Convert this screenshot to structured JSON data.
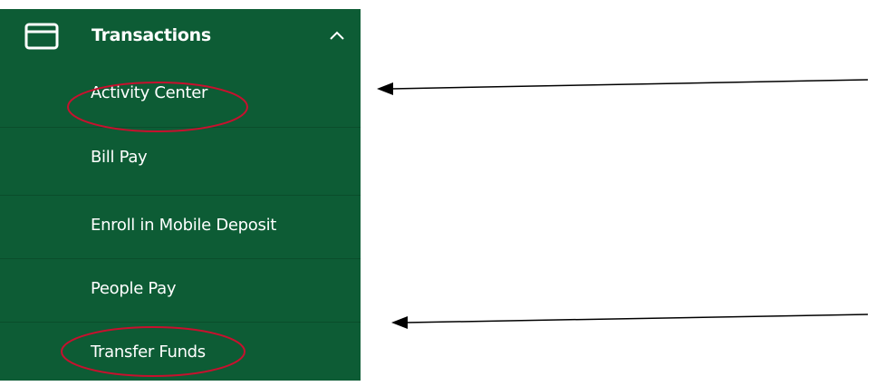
{
  "sidebar": {
    "section": {
      "label": "Transactions",
      "icon": "credit-card-icon",
      "toggle_icon": "chevron-up-icon",
      "expanded": true
    },
    "items": [
      {
        "label": "Activity Center",
        "highlighted": true
      },
      {
        "label": "Bill Pay",
        "highlighted": false
      },
      {
        "label": "Enroll in Mobile Deposit",
        "highlighted": false
      },
      {
        "label": "People Pay",
        "highlighted": false
      },
      {
        "label": "Transfer Funds",
        "highlighted": true
      }
    ]
  },
  "colors": {
    "sidebar_background": "#0d5c35",
    "text": "#ffffff",
    "highlight_ellipse": "#c8102e",
    "arrow": "#000000"
  }
}
